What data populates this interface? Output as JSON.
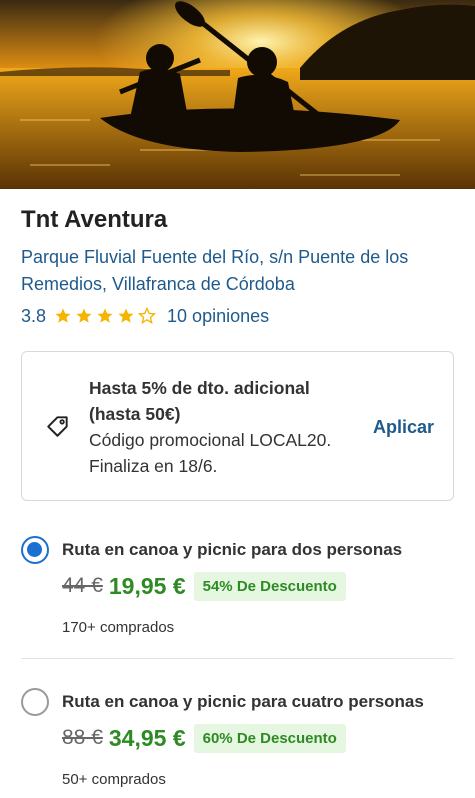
{
  "hero": {
    "image": "kayak-sunset-photo"
  },
  "business": {
    "name": "Tnt Aventura",
    "address": "Parque Fluvial Fuente del Río, s/n Puente de los Remedios, Villafranca de Córdoba",
    "rating": "3.8",
    "rating_value": 3.8,
    "stars": [
      "full",
      "full",
      "full",
      "full",
      "empty"
    ],
    "reviews": "10 opiniones"
  },
  "promo": {
    "icon": "tag-icon",
    "headline": "Hasta 5% de dto. adicional (hasta 50€)",
    "body": "Código promocional LOCAL20. Finaliza en 18/6.",
    "apply_label": "Aplicar"
  },
  "options": [
    {
      "title": "Ruta en canoa y picnic para dos personas",
      "old_price": "44 €",
      "new_price": "19,95 €",
      "discount": "54% De Descuento",
      "bought": "170+ comprados",
      "selected": true
    },
    {
      "title": "Ruta en canoa y picnic para cuatro personas",
      "old_price": "88 €",
      "new_price": "34,95 €",
      "discount": "60% De Descuento",
      "bought": "50+ comprados",
      "selected": false
    }
  ],
  "colors": {
    "link": "#1f5a8c",
    "star": "#f5b400",
    "price_green": "#2e8b24",
    "discount_bg": "#e5f6e1",
    "radio_blue": "#1a6fd1"
  }
}
